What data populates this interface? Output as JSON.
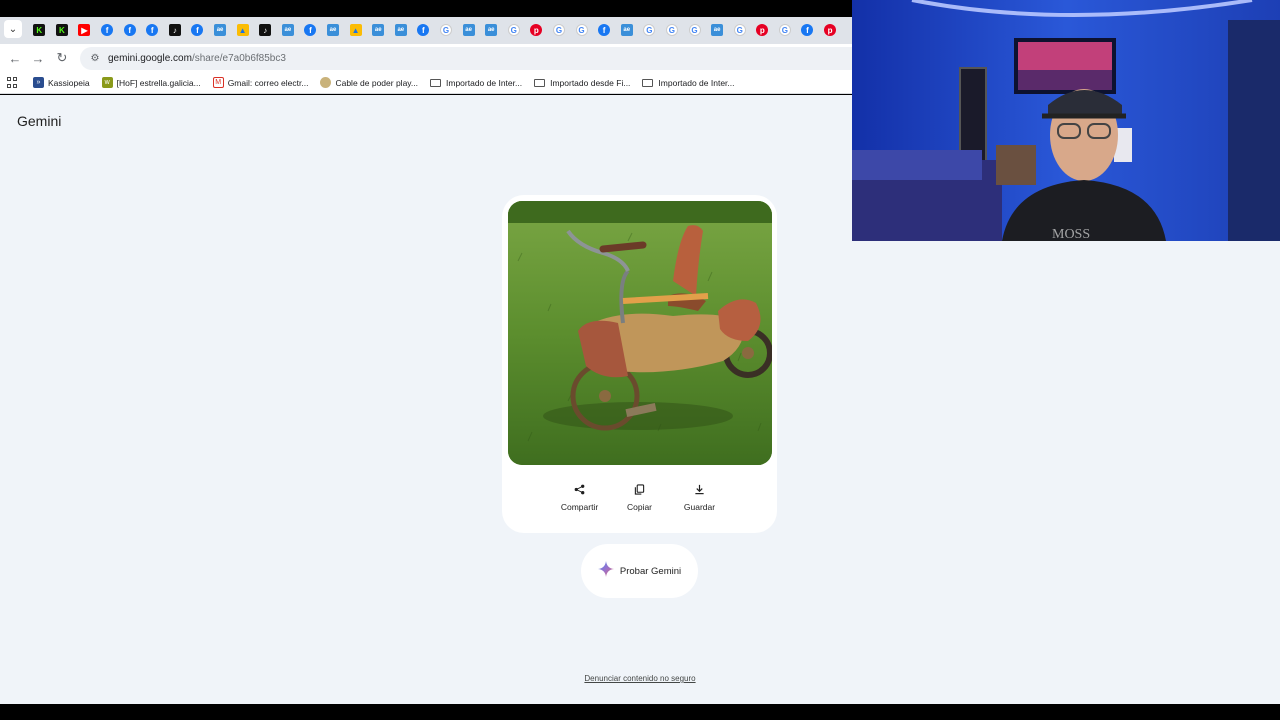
{
  "browser": {
    "tab_favicons": [
      "kick-icon",
      "kick-icon",
      "youtube-icon",
      "facebook-icon",
      "facebook-icon",
      "facebook-icon",
      "tiktok-icon",
      "facebook-icon",
      "ae-icon",
      "drive-icon",
      "tiktok-icon",
      "ae-icon",
      "facebook-icon",
      "ae-icon",
      "drive-icon",
      "ae-icon",
      "ae-icon",
      "facebook-icon",
      "google-icon",
      "ae-icon",
      "ae-icon",
      "google-icon",
      "pinterest-icon",
      "google-icon",
      "google-icon",
      "facebook-icon",
      "ae-icon",
      "google-icon",
      "google-icon",
      "google-icon",
      "ae-icon",
      "google-icon",
      "pinterest-icon",
      "google-icon",
      "facebook-icon",
      "pinterest-icon"
    ],
    "url_host": "gemini.google.com",
    "url_path": "/share/e7a0b6f85bc3",
    "bookmarks": [
      {
        "label": "Kassiopeia",
        "icon": "kassiopeia-icon"
      },
      {
        "label": "[HoF] estrella.galicia...",
        "icon": "hof-icon"
      },
      {
        "label": "Gmail: correo electr...",
        "icon": "gmail-icon"
      },
      {
        "label": "Cable de poder play...",
        "icon": "cable-icon"
      },
      {
        "label": "Importado de Inter...",
        "icon": "folder-icon"
      },
      {
        "label": "Importado desde Fi...",
        "icon": "folder-icon"
      },
      {
        "label": "Importado de Inter...",
        "icon": "folder-icon"
      }
    ]
  },
  "page": {
    "brand": "Gemini",
    "image_subject": "vintage rusty tricycle on grass",
    "actions": [
      {
        "label": "Compartir",
        "icon": "share-icon"
      },
      {
        "label": "Copiar",
        "icon": "copy-icon"
      },
      {
        "label": "Guardar",
        "icon": "download-icon"
      }
    ],
    "try_button": "Probar Gemini",
    "report_link": "Denunciar contenido no seguro"
  },
  "colors": {
    "page_bg": "#f0f4f9",
    "tabstrip_bg": "#dfe3e9",
    "webcam_wall": "#1a3fb8"
  }
}
